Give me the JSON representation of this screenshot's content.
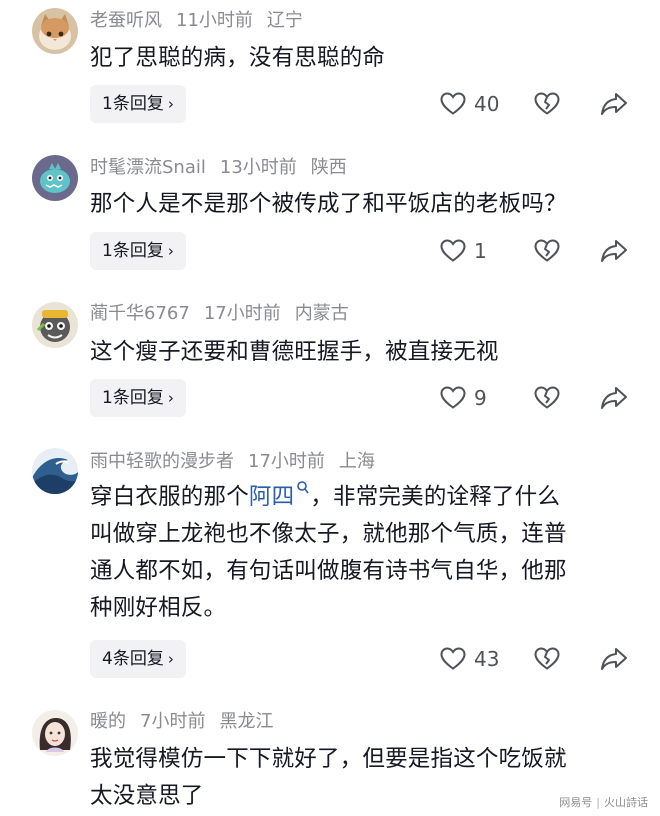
{
  "comments": [
    {
      "username": "老蚕听风",
      "time": "11小时前",
      "location": "辽宁",
      "text_lines": [
        "犯了思聪的病，没有思聪的命"
      ],
      "replies": "1条回复",
      "likes": "40"
    },
    {
      "username": "时髦漂流Snail",
      "time": "13小时前",
      "location": "陕西",
      "text_lines": [
        "那个人是不是那个被传成了和平饭店的老板吗？"
      ],
      "replies": "1条回复",
      "likes": "1"
    },
    {
      "username": "蔺千华6767",
      "time": "17小时前",
      "location": "内蒙古",
      "text_lines": [
        "这个瘦子还要和曹德旺握手，被直接无视"
      ],
      "replies": "1条回复",
      "likes": "9"
    },
    {
      "username": "雨中轻歌的漫步者",
      "time": "17小时前",
      "location": "上海",
      "text_pre": "穿白衣服的那个",
      "text_link": "阿四",
      "text_post": "，非常完美的诠释了什么",
      "text_lines": [
        "叫做穿上龙袍也不像太子，就他那个气质，连普",
        "通人都不如，有句话叫做腹有诗书气自华，他那",
        "种刚好相反。"
      ],
      "replies": "4条回复",
      "likes": "43"
    },
    {
      "username": "暖的",
      "time": "7小时前",
      "location": "黑龙江",
      "text_lines": [
        "我觉得模仿一下下就好了，但要是指这个吃饭就",
        "太没意思了"
      ]
    }
  ],
  "watermark": {
    "left": "网易号",
    "right": "火山詩话"
  }
}
